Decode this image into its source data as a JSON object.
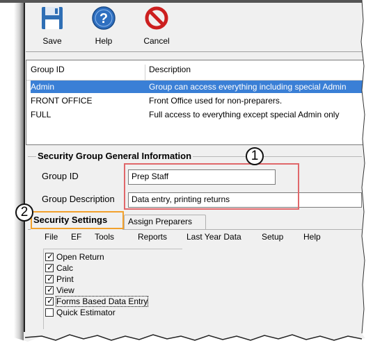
{
  "toolbar": {
    "save_label": "Save",
    "help_label": "Help",
    "cancel_label": "Cancel"
  },
  "grid": {
    "headers": [
      "Group ID",
      "Description"
    ],
    "rows": [
      {
        "id": "Admin",
        "description": "Group can access everything including special Admin",
        "selected": true
      },
      {
        "id": "FRONT OFFICE",
        "description": "Front Office used for non-preparers.",
        "selected": false
      },
      {
        "id": "FULL",
        "description": "Full access to everything except special Admin only",
        "selected": false
      }
    ]
  },
  "info": {
    "section_title": "Security Group General Information",
    "group_id_label": "Group ID",
    "group_id_value": "Prep Staff",
    "group_desc_label": "Group Description",
    "group_desc_value": "Data entry, printing returns"
  },
  "callouts": {
    "one": "1",
    "two": "2"
  },
  "tabs": {
    "security_settings": "Security Settings",
    "assign_preparers": "Assign Preparers"
  },
  "menu": [
    "File",
    "EF",
    "Tools",
    "Reports",
    "Last Year Data",
    "Setup",
    "Help"
  ],
  "permissions": [
    {
      "label": "Open Return",
      "checked": true
    },
    {
      "label": "Calc",
      "checked": true
    },
    {
      "label": "Print",
      "checked": true
    },
    {
      "label": "View",
      "checked": true
    },
    {
      "label": "Forms Based  Data Entry",
      "checked": true
    },
    {
      "label": "Quick Estimator",
      "checked": false
    }
  ],
  "colors": {
    "selection": "#3a7fd6",
    "annotation_red": "#e0676a",
    "annotation_orange": "#f2a12c"
  }
}
